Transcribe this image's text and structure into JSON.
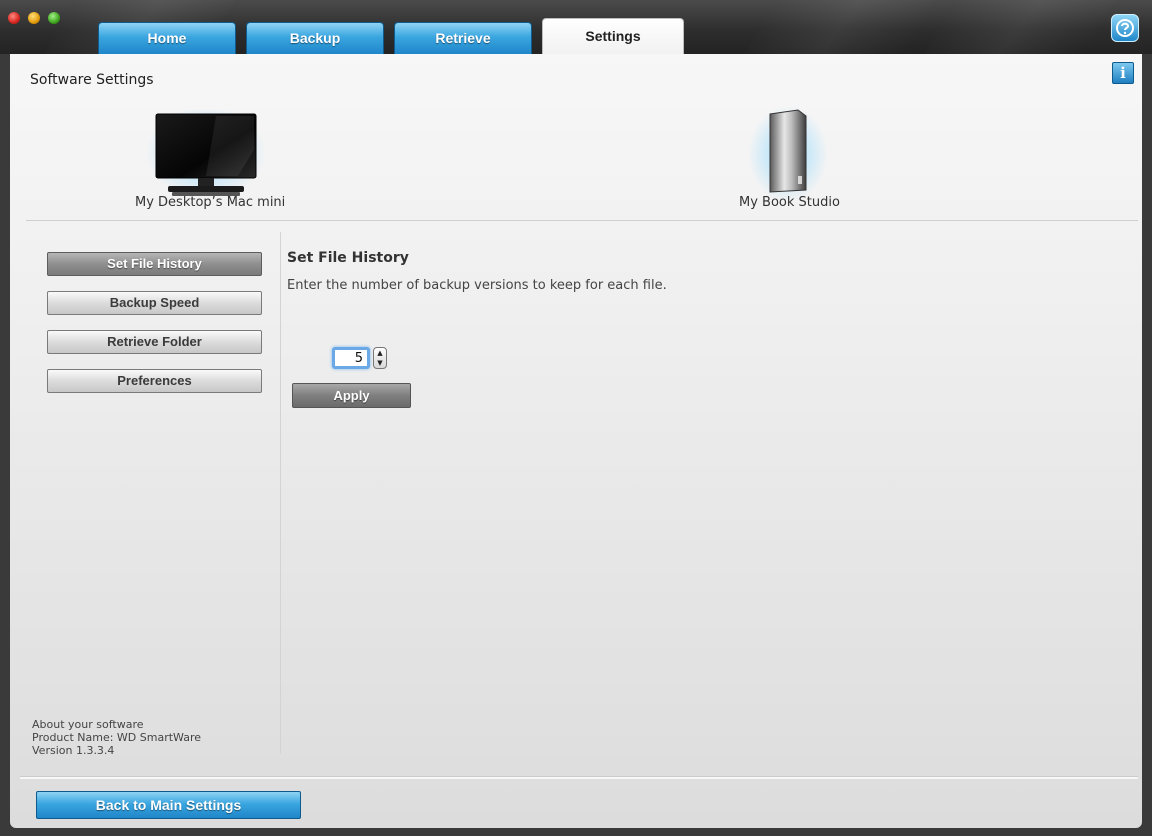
{
  "tabs": [
    {
      "label": "Home"
    },
    {
      "label": "Backup"
    },
    {
      "label": "Retrieve"
    },
    {
      "label": "Settings"
    }
  ],
  "active_tab": "Settings",
  "header": {
    "title": "Software Settings",
    "info_glyph": "i",
    "help_icon": "question-mark-icon",
    "info_icon": "info-icon"
  },
  "devices": [
    {
      "label": "My Desktop’s Mac mini",
      "icon": "monitor-icon"
    },
    {
      "label": "My Book Studio",
      "icon": "external-drive-icon"
    }
  ],
  "sidebar": {
    "items": [
      {
        "label": "Set File History",
        "selected": true
      },
      {
        "label": "Backup Speed",
        "selected": false
      },
      {
        "label": "Retrieve Folder",
        "selected": false
      },
      {
        "label": "Preferences",
        "selected": false
      }
    ]
  },
  "panel": {
    "title": "Set File History",
    "description": "Enter the number of backup versions to keep for each file.",
    "versions_value": "5",
    "apply_label": "Apply"
  },
  "about": {
    "heading": "About your software",
    "product": "Product Name: WD SmartWare",
    "version": "Version 1.3.3.4"
  },
  "footer": {
    "back_label": "Back to Main Settings"
  },
  "colors": {
    "accent_blue": "#1f86c9",
    "titlebar": "#2e2e2e",
    "content_bg": "#f0f0f0"
  }
}
